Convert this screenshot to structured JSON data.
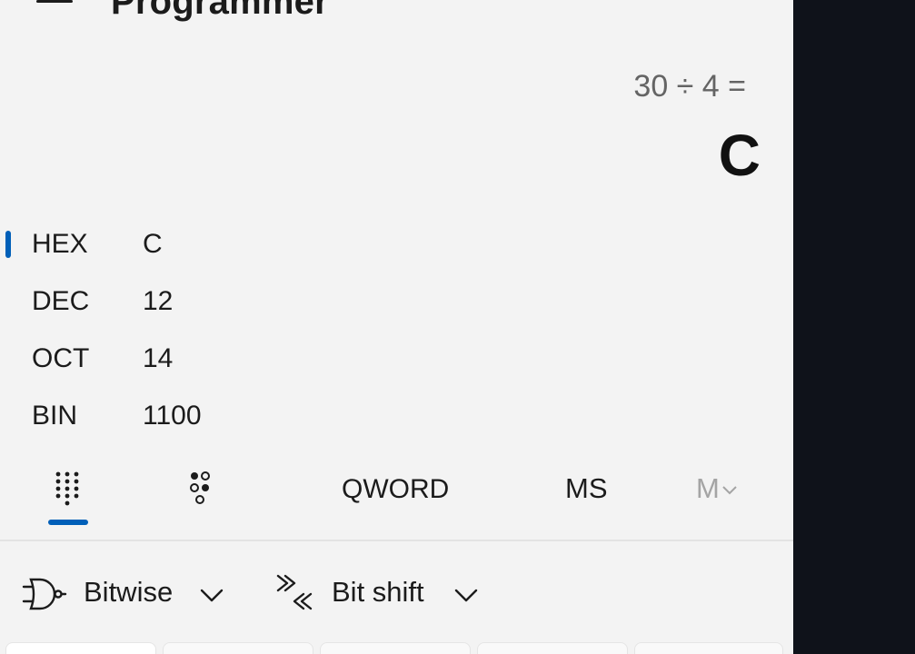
{
  "header": {
    "menu_icon": "hamburger-icon",
    "title": "Programmer"
  },
  "display": {
    "expression": "30 ÷ 4 =",
    "result": "C"
  },
  "radix": [
    {
      "label": "HEX",
      "value": "C",
      "selected": true
    },
    {
      "label": "DEC",
      "value": "12",
      "selected": false
    },
    {
      "label": "OCT",
      "value": "14",
      "selected": false
    },
    {
      "label": "BIN",
      "value": "1100",
      "selected": false
    }
  ],
  "toolbar": {
    "keypad_icon": "full-keypad-icon",
    "bit_toggle_icon": "bit-toggling-keypad-icon",
    "word_size": "QWORD",
    "memory_store": "MS",
    "memory_list": "M"
  },
  "operators": {
    "bitwise_label": "Bitwise",
    "bitwise_icon": "logic-gate-icon",
    "bitshift_label": "Bit shift",
    "bitshift_icon": "bit-shift-icon"
  },
  "colors": {
    "accent": "#005fb8",
    "app_background": "#f3f3f3",
    "outer_background": "#0f121a"
  }
}
